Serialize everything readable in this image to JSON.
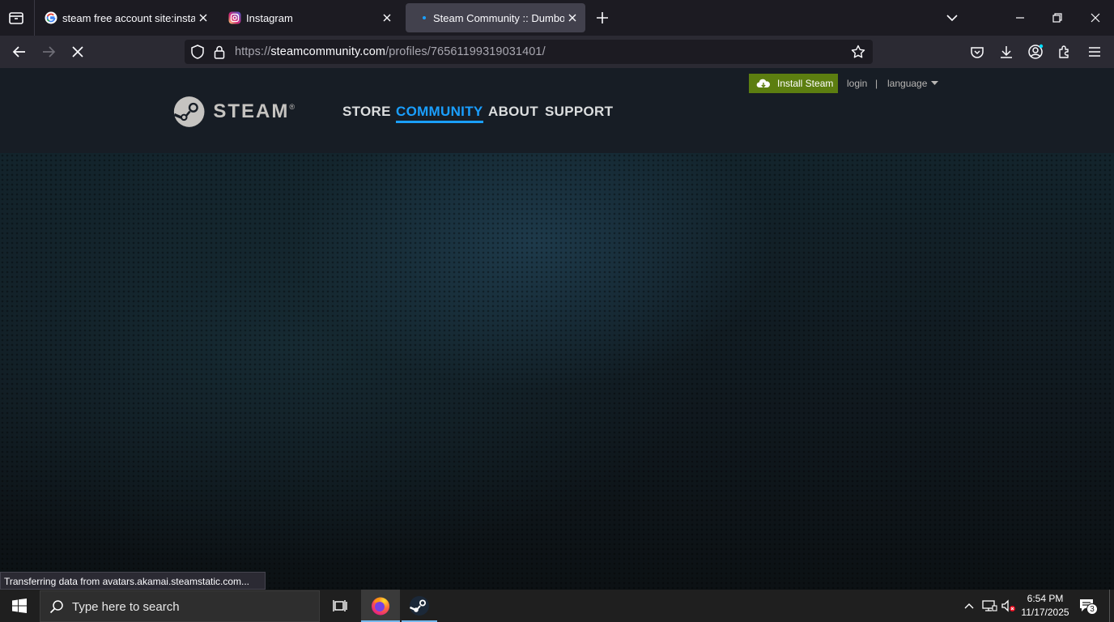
{
  "browser": {
    "tabs": [
      {
        "title": "steam free account site:instagra",
        "favicon": "google-icon",
        "active": false
      },
      {
        "title": "Instagram",
        "favicon": "instagram-icon",
        "active": false
      },
      {
        "title": "Steam Community :: Dumbolov",
        "favicon": "loading-dot-icon",
        "active": true
      }
    ],
    "url": {
      "scheme": "https://",
      "host": "steamcommunity.com",
      "path": "/profiles/76561199319031401/"
    },
    "status_text": "Transferring data from avatars.akamai.steamstatic.com..."
  },
  "steam": {
    "logo_text": "STEAM",
    "logo_mark": "®",
    "nav": [
      "STORE",
      "COMMUNITY",
      "ABOUT",
      "SUPPORT"
    ],
    "active_nav": "COMMUNITY",
    "install_label": "Install Steam",
    "login_label": "login",
    "separator": "|",
    "language_label": "language",
    "colors": {
      "accent": "#1a9fff",
      "install_bg": "#5c7e10",
      "header_bg": "#171d25"
    }
  },
  "taskbar": {
    "search_placeholder": "Type here to search",
    "time": "6:54 PM",
    "date": "11/17/2025",
    "notification_count": "3"
  }
}
